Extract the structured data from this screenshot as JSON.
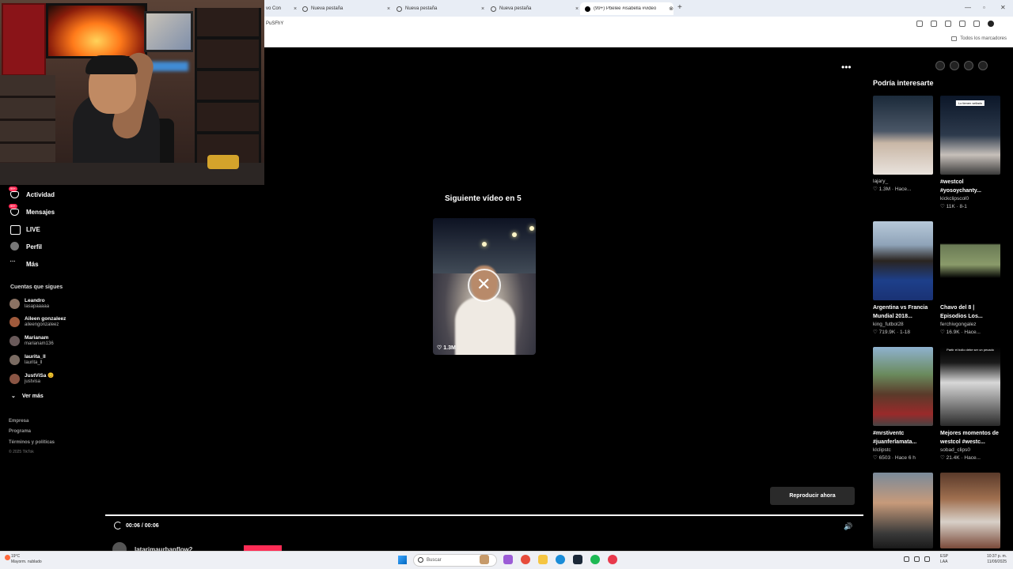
{
  "browser": {
    "tabs": [
      {
        "label": "vo Con"
      },
      {
        "label": "Nueva pestaña"
      },
      {
        "label": "Nueva pestaña"
      },
      {
        "label": "Nueva pestaña"
      },
      {
        "label": "(99+) Pbelee #isabella #video"
      }
    ],
    "address": "PuSFhY",
    "bookmarks_all": "Todos los marcadores"
  },
  "nav": {
    "items": [
      {
        "label": "Actividad",
        "badge": "99+"
      },
      {
        "label": "Mensajes",
        "badge": "99+"
      },
      {
        "label": "LIVE"
      },
      {
        "label": "Perfil"
      },
      {
        "label": "Más"
      }
    ],
    "following_title": "Cuentas que sigues",
    "following": [
      {
        "name": "Leandro",
        "handle": "lasapaaaaa"
      },
      {
        "name": "Aileen gonzaleez",
        "handle": "aileengonzaleez"
      },
      {
        "name": "Marianam",
        "handle": "marianam136"
      },
      {
        "name": "laurita_ll",
        "handle": "laurita_ll"
      },
      {
        "name": "JustViSa 😊",
        "handle": "justvisa"
      }
    ],
    "see_more": "Ver más",
    "footer": [
      "Empresa",
      "Programa",
      "Términos y políticas"
    ],
    "copyright": "© 2025 TikTok"
  },
  "player": {
    "next_label": "Siguiente vídeo en 5",
    "next_likes": "1.3M",
    "play_now": "Reproducir ahora",
    "time": "00:06 / 00:06",
    "progress": 1.0,
    "author": "latarimaurbanflow2"
  },
  "sidebar": {
    "title": "Podría interesarte",
    "cards": [
      {
        "title": "",
        "handle": "lajary_",
        "meta": "♡ 1.3M · Hace...",
        "tag": ""
      },
      {
        "title": "#westcol #yosoychanty...",
        "handle": "kickclipscol0",
        "meta": "♡ 11K · 8-1",
        "tag": "Lo tienen sellado"
      },
      {
        "title": "Argentina vs Francia Mundial 2018...",
        "handle": "king_futbol28",
        "meta": "♡ 719.9K · 1-18",
        "tag": ""
      },
      {
        "title": "Chavo del 8 | Episodios Los...",
        "handle": "ferchivgongalez",
        "meta": "♡ 16.9K · Hace...",
        "tag": ""
      },
      {
        "title": "#mrstiventc #juanferlamata...",
        "handle": "klclipstc",
        "meta": "♡ 6503 · Hace 6 h",
        "tag": ""
      },
      {
        "title": "Mejores momentos de westcol #westc...",
        "handle": "sobad_clips0",
        "meta": "♡ 21.4K · Hace...",
        "tag": "Partir el bollo debe ser un pecado"
      },
      {
        "title": "",
        "handle": "",
        "meta": "",
        "tag": ""
      },
      {
        "title": "",
        "handle": "",
        "meta": "",
        "tag": ""
      }
    ]
  },
  "taskbar": {
    "weather_temp": "19°C",
    "weather_desc": "Mayorm. nublado",
    "search": "Buscar",
    "lang": "ESP",
    "lang2": "LAA",
    "time": "10:37 p. m.",
    "date": "11/09/2025"
  }
}
